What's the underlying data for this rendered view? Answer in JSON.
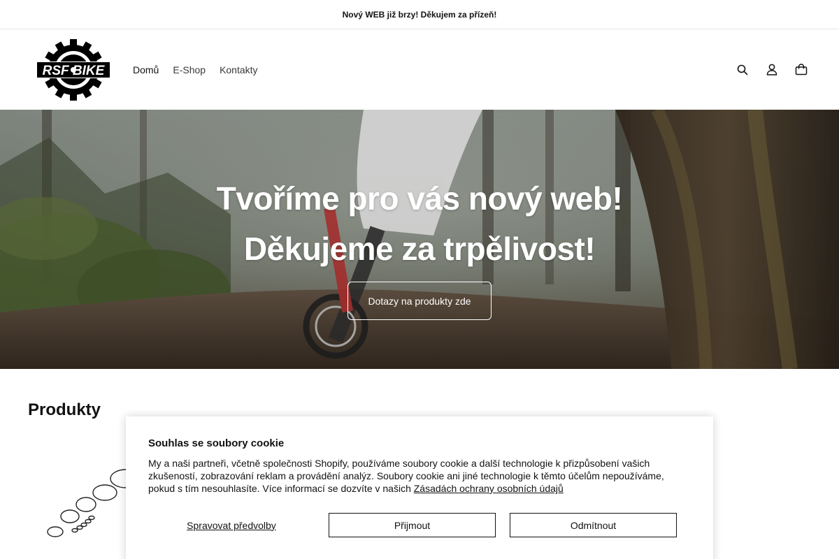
{
  "announcement": {
    "text": "Nový WEB již brzy! Děkujem za přízeň!"
  },
  "header": {
    "logo_text": "RSF BIKE",
    "nav": [
      {
        "label": "Domů",
        "active": true
      },
      {
        "label": "E-Shop",
        "active": false
      },
      {
        "label": "Kontakty",
        "active": false
      }
    ],
    "icons": [
      "search-icon",
      "account-icon",
      "cart-icon"
    ]
  },
  "hero": {
    "line1": "Tvoříme pro vás nový web!",
    "line2": "Děkujeme za trpělivost!",
    "button_label": "Dotazy na produkty zde"
  },
  "products": {
    "title": "Produkty"
  },
  "cookie": {
    "title": "Souhlas se soubory cookie",
    "body": "My a naši partneři, včetně společnosti Shopify, používáme soubory cookie a další technologie k přizpůsobení vašich zkušeností, zobrazování reklam a provádění analýz. Soubory cookie ani jiné technologie k těmto účelům nepoužíváme, pokud s tím nesouhlasíte. Více informací se dozvíte v našich ",
    "link": "Zásadách ochrany osobních údajů",
    "manage_label": "Spravovat předvolby",
    "accept_label": "Přijmout",
    "decline_label": "Odmítnout"
  },
  "colors": {
    "text": "#121212",
    "border": "#e6e6e6",
    "background": "#ffffff"
  }
}
